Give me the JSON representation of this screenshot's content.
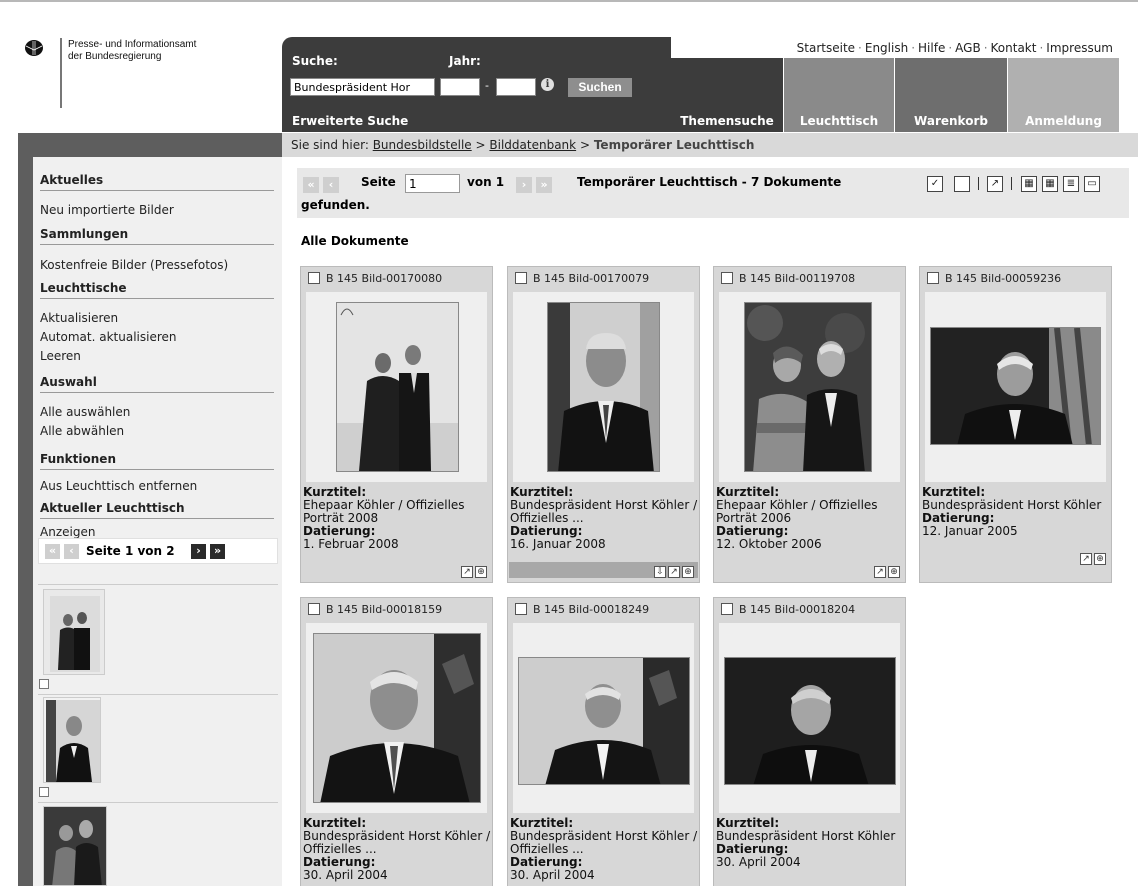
{
  "brand": {
    "name_line1": "Presse- und Informationsamt",
    "name_line2": "der Bundesregierung"
  },
  "search": {
    "label": "Suche:",
    "year_label": "Jahr:",
    "value": "Bundespräsident Hor",
    "year_dash": "-",
    "info_symbol": "i",
    "button": "Suchen",
    "advanced": "Erweiterte Suche"
  },
  "toplinks": [
    "Startseite",
    "English",
    "Hilfe",
    "AGB",
    "Kontakt",
    "Impressum"
  ],
  "tabs": [
    "Themensuche",
    "Leuchttisch",
    "Warenkorb",
    "Anmeldung"
  ],
  "breadcrumb": {
    "prefix": "Sie sind hier:",
    "item1": "Bundesbildstelle",
    "sep": ">",
    "item2": "Bilddatenbank",
    "current": "Temporärer Leuchttisch"
  },
  "sidebar": {
    "h_aktuelles": "Aktuelles",
    "i_neu": "Neu importierte Bilder",
    "h_sammlungen": "Sammlungen",
    "i_kostenfrei": "Kostenfreie Bilder (Pressefotos)",
    "h_leuchttische": "Leuchttische",
    "i_aktualisieren": "Aktualisieren",
    "i_automat": "Automat. aktualisieren",
    "i_leeren": "Leeren",
    "h_auswahl": "Auswahl",
    "i_alle_aus": "Alle auswählen",
    "i_alle_ab": "Alle abwählen",
    "h_funktionen": "Funktionen",
    "i_entfernen": "Aus Leuchttisch entfernen",
    "h_aktueller": "Aktueller Leuchttisch",
    "i_anzeigen": "Anzeigen",
    "pager_label": "Seite 1 von 2"
  },
  "pager_symbols": {
    "first": "«",
    "prev": "‹",
    "next": "›",
    "last": "»"
  },
  "toolbar": {
    "seite": "Seite",
    "page_value": "1",
    "von": "von 1",
    "title": "Temporärer Leuchttisch - 7 Dokumente",
    "gefunden": "gefunden."
  },
  "section_title": "Alle Dokumente",
  "cards": [
    {
      "id": "B 145 Bild-00170080",
      "k1": "Kurztitel:",
      "title": "Ehepaar Köhler / Offizielles Porträt 2008",
      "k2": "Datierung:",
      "date": "1. Februar 2008"
    },
    {
      "id": "B 145 Bild-00170079",
      "k1": "Kurztitel:",
      "title": "Bundespräsident Horst Köhler / Offizielles ...",
      "k2": "Datierung:",
      "date": "16. Januar 2008"
    },
    {
      "id": "B 145 Bild-00119708",
      "k1": "Kurztitel:",
      "title": "Ehepaar Köhler / Offizielles Porträt 2006",
      "k2": "Datierung:",
      "date": "12. Oktober 2006"
    },
    {
      "id": "B 145 Bild-00059236",
      "k1": "Kurztitel:",
      "title": "Bundespräsident Horst Köhler",
      "k2": "Datierung:",
      "date": "12. Januar 2005"
    },
    {
      "id": "B 145 Bild-00018159",
      "k1": "Kurztitel:",
      "title": "Bundespräsident Horst Köhler / Offizielles ...",
      "k2": "Datierung:",
      "date": "30. April 2004"
    },
    {
      "id": "B 145 Bild-00018249",
      "k1": "Kurztitel:",
      "title": "Bundespräsident Horst Köhler / Offizielles ...",
      "k2": "Datierung:",
      "date": "30. April 2004"
    },
    {
      "id": "B 145 Bild-00018204",
      "k1": "Kurztitel:",
      "title": "Bundespräsident Horst Köhler",
      "k2": "Datierung:",
      "date": "30. April 2004"
    }
  ]
}
